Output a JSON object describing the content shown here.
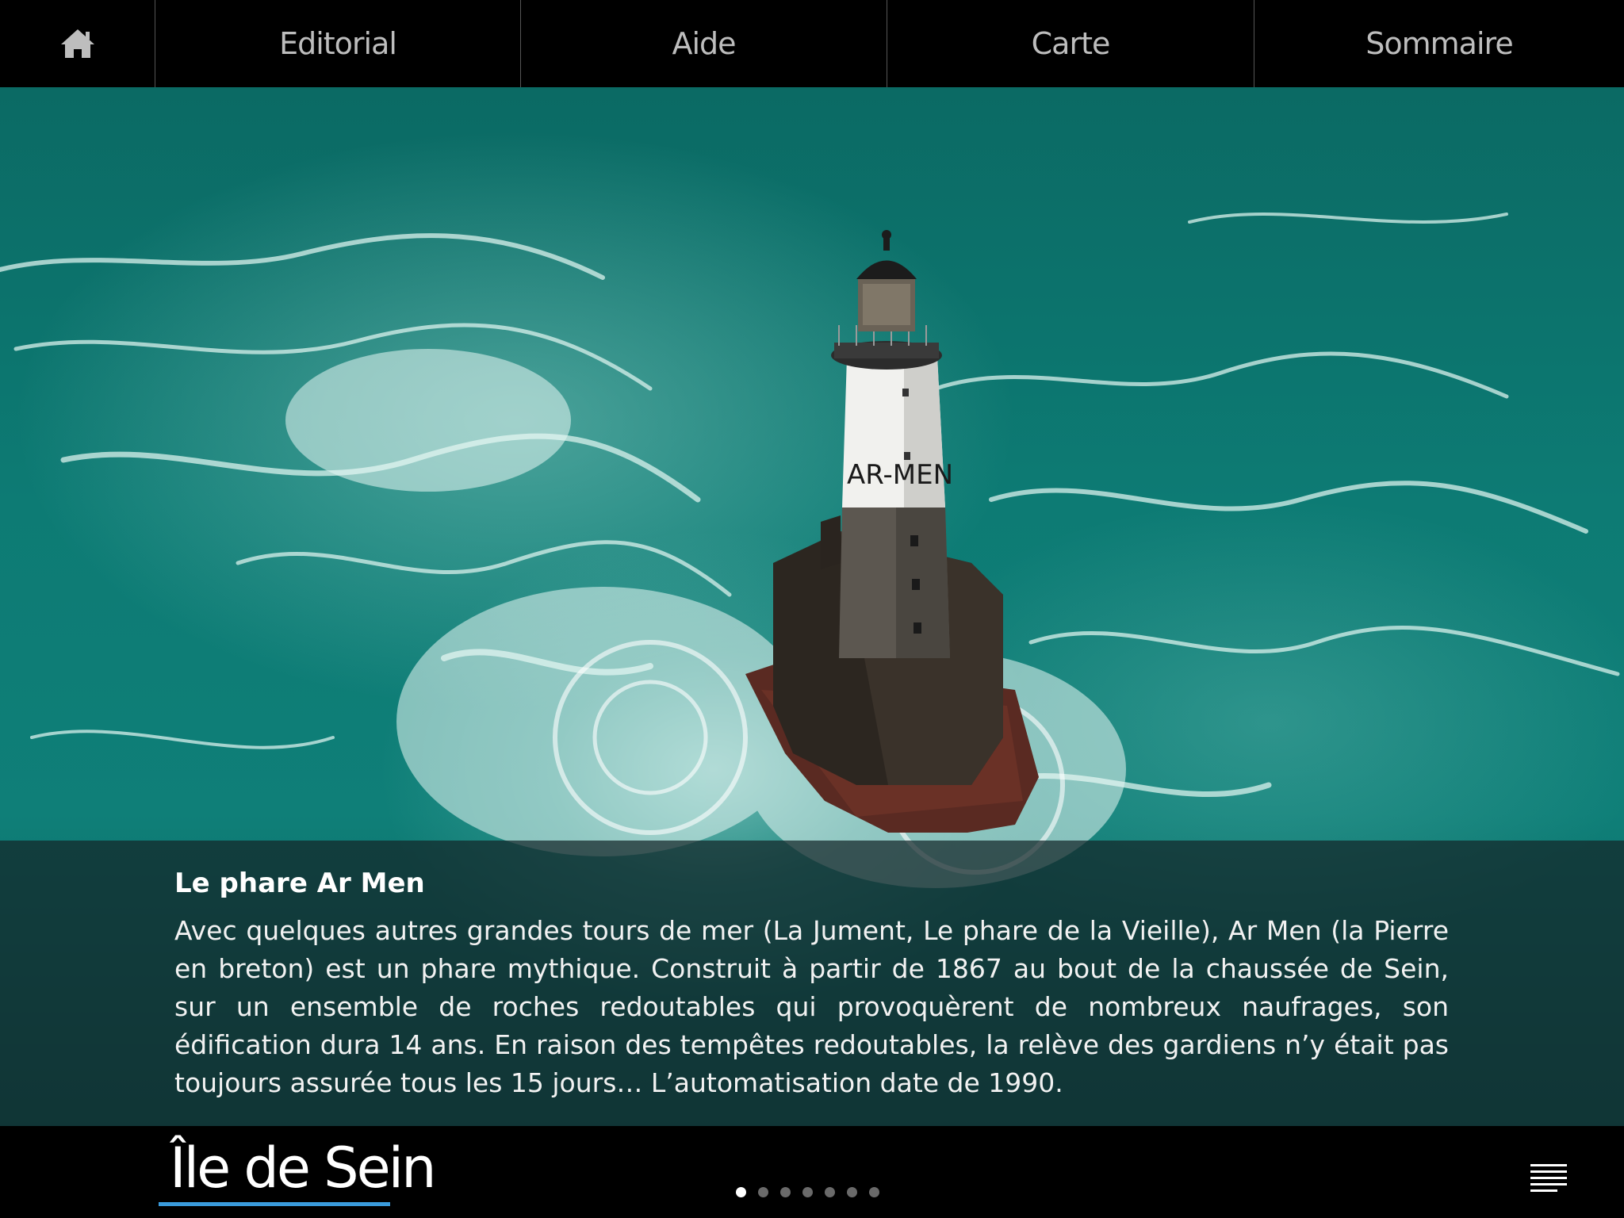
{
  "nav": {
    "home_icon": "home-icon",
    "items": [
      {
        "label": "Editorial"
      },
      {
        "label": "Aide"
      },
      {
        "label": "Carte"
      },
      {
        "label": "Sommaire"
      }
    ]
  },
  "photo": {
    "lighthouse_lettering": "AR-MEN"
  },
  "caption": {
    "title": "Le phare Ar Men",
    "body": "Avec quelques autres grandes tours de mer (La Jument, Le phare de la Vieille), Ar Men (la Pierre en breton) est un phare mythique. Construit à partir de 1867 au bout de la chaussée de Sein, sur un ensemble de roches redoutables qui provoquèrent de nombreux naufrages, son édification dura 14 ans. En raison des tempêtes redoutables, la relève des gardiens n’y était pas toujours assurée tous les 15 jours… L’automatisation date de 1990."
  },
  "footer": {
    "brand": "Île de Sein",
    "page_dots": 7,
    "active_page": 1,
    "menu_icon": "menu-lines-icon"
  },
  "colors": {
    "accent": "#3a9bdc",
    "sea": "#0d7b74",
    "bar": "#000000",
    "nav_text": "#bdbdbd"
  }
}
